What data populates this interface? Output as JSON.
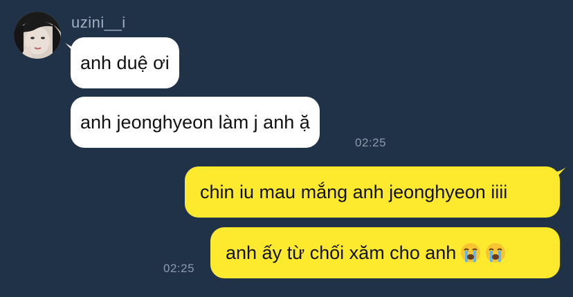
{
  "chat": {
    "sender_name": "uzini__i",
    "incoming": {
      "msg1": "anh duệ ơi",
      "msg2": "anh jeonghyeon làm j anh ặ",
      "time": "02:25"
    },
    "outgoing": {
      "msg1": "chin iu mau mắng anh jeonghyeon iiii",
      "msg2": "anh ấy từ chối xăm cho anh",
      "time": "02:25",
      "emoji_icons": [
        "loudly-crying-face-icon",
        "loudly-crying-face-icon"
      ]
    }
  },
  "colors": {
    "background": "#1f3247",
    "incoming_bubble": "#ffffff",
    "outgoing_bubble": "#fde92e",
    "sender_text": "#9fb0c2",
    "timestamp_text": "#8d9cac"
  }
}
